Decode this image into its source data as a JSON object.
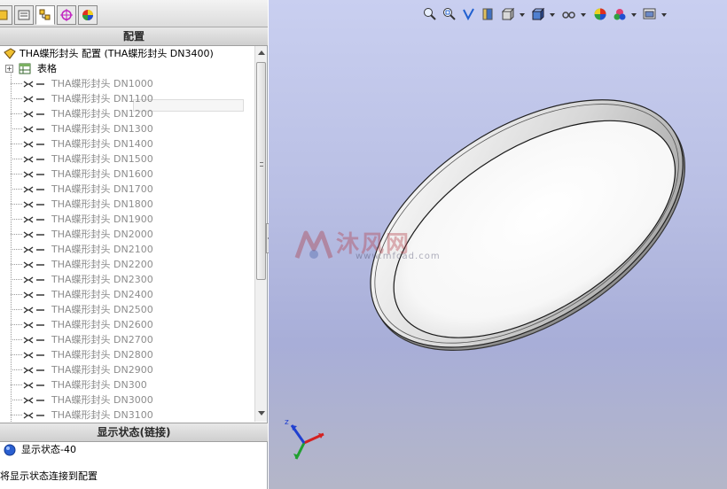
{
  "config_panel": {
    "header": "配置",
    "root_label": "THA蝶形封头 配置  (THA蝶形封头 DN3400)",
    "tooltip_ghost": "",
    "table_label": "表格",
    "configurations": [
      "THA蝶形封头 DN1000",
      "THA蝶形封头 DN1100",
      "THA蝶形封头 DN1200",
      "THA蝶形封头 DN1300",
      "THA蝶形封头 DN1400",
      "THA蝶形封头 DN1500",
      "THA蝶形封头 DN1600",
      "THA蝶形封头 DN1700",
      "THA蝶形封头 DN1800",
      "THA蝶形封头 DN1900",
      "THA蝶形封头 DN2000",
      "THA蝶形封头 DN2100",
      "THA蝶形封头 DN2200",
      "THA蝶形封头 DN2300",
      "THA蝶形封头 DN2400",
      "THA蝶形封头 DN2500",
      "THA蝶形封头 DN2600",
      "THA蝶形封头 DN2700",
      "THA蝶形封头 DN2800",
      "THA蝶形封头 DN2900",
      "THA蝶形封头 DN300",
      "THA蝶形封头 DN3000",
      "THA蝶形封头 DN3100"
    ]
  },
  "display_panel": {
    "header": "显示状态(链接)",
    "state_label": "显示状态-40",
    "status_text": "将显示状态连接到配置"
  },
  "watermark": {
    "name": "沐风网",
    "url": "www.mfcad.com"
  },
  "icons": {
    "tabs": [
      "feature-manager-icon",
      "property-manager-icon",
      "configuration-manager-icon",
      "dimxpert-icon",
      "display-manager-icon"
    ],
    "heads_up": [
      "zoom-to-fit-icon",
      "zoom-area-icon",
      "previous-view-icon",
      "section-view-icon",
      "view-orientation-icon",
      "display-style-icon",
      "hide-show-items-icon",
      "edit-appearance-icon",
      "apply-scene-icon",
      "view-settings-icon"
    ]
  },
  "colors": {
    "viewport_top": "#c9cff0",
    "viewport_bottom": "#b4b6c8",
    "config_text": "#8c8c8c",
    "axis_x": "#d42020",
    "axis_y": "#20a030",
    "axis_z": "#2040d0"
  }
}
